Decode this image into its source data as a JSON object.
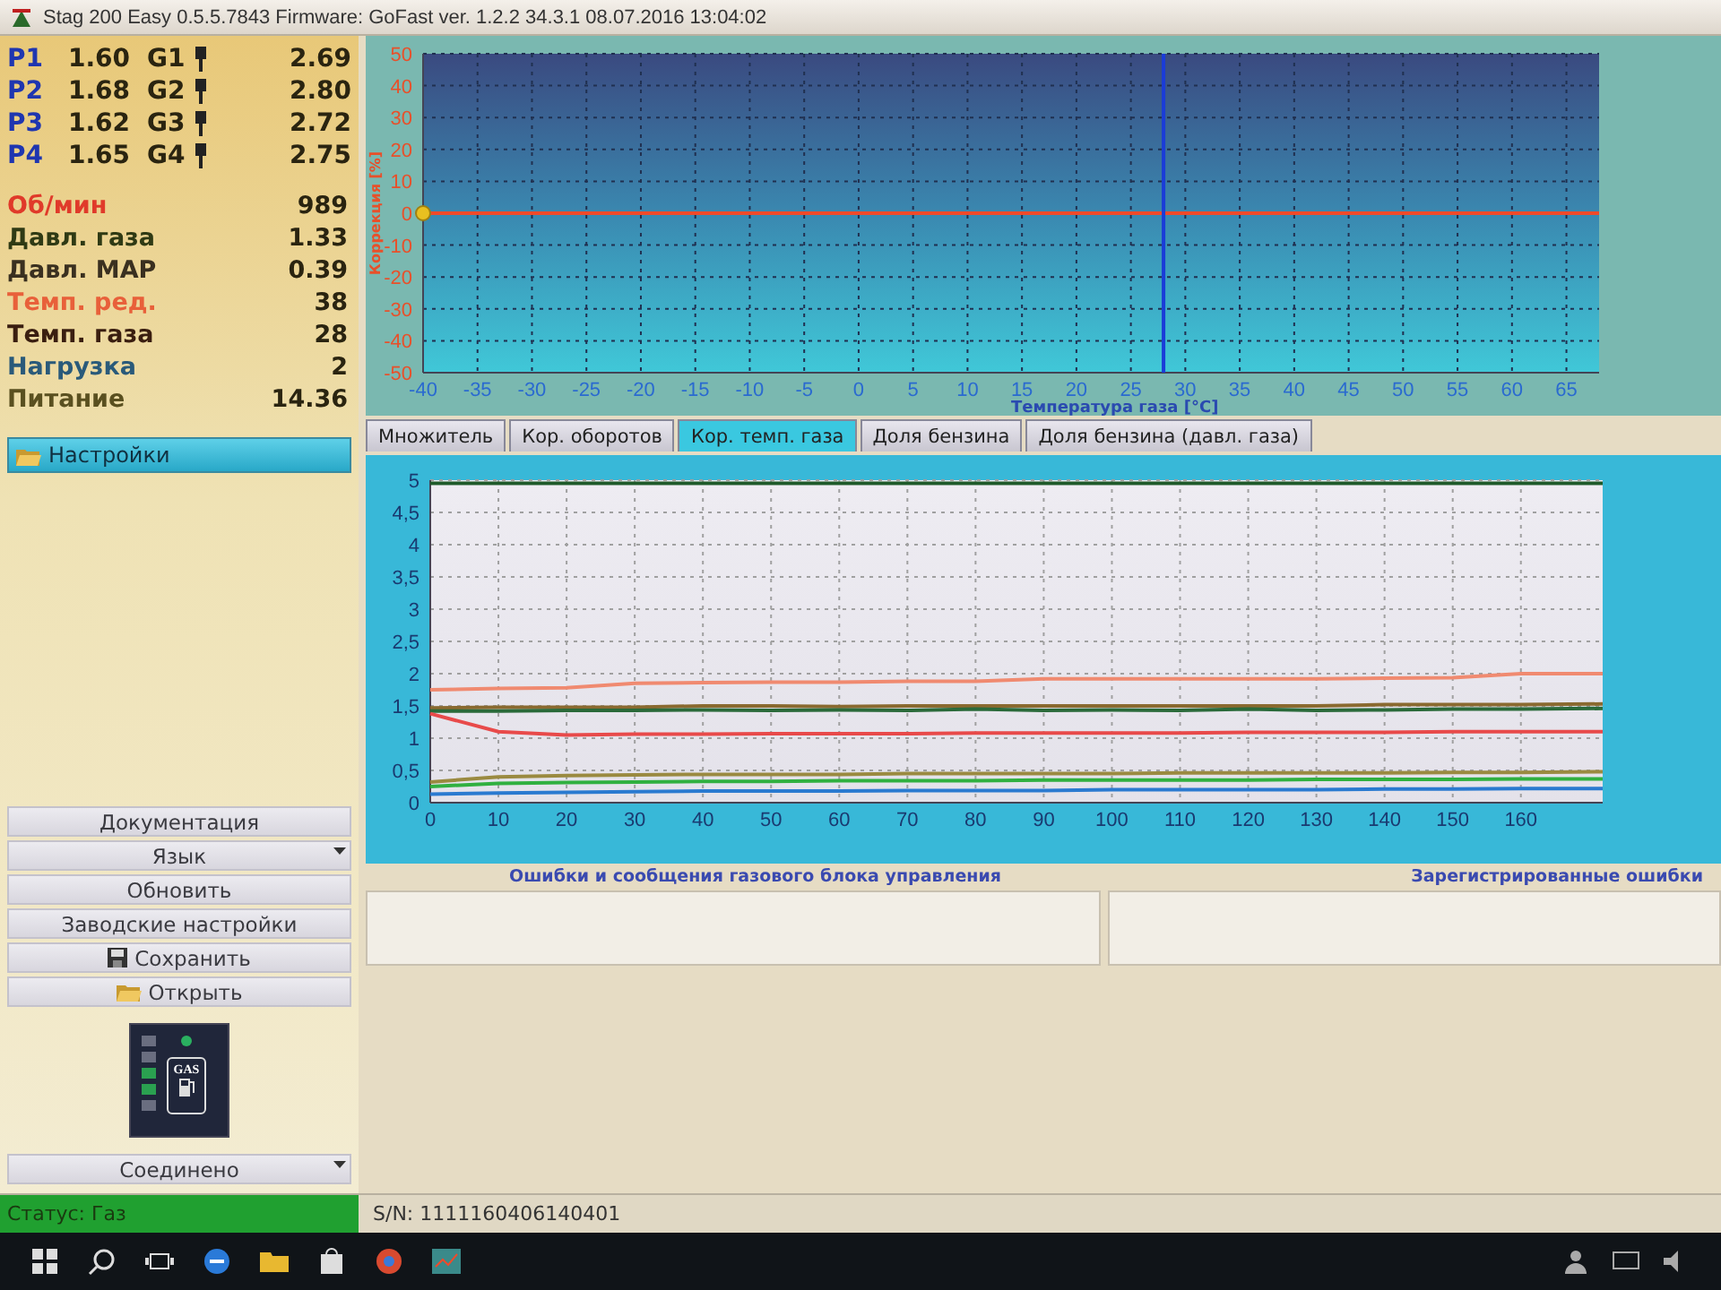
{
  "window": {
    "title": "Stag 200 Easy 0.5.5.7843 Firmware: GoFast  ver. 1.2.2  34.3.1   08.07.2016 13:04:02"
  },
  "injectors": [
    {
      "p_label": "P1",
      "p_value": "1.60",
      "g_label": "G1",
      "g_value": "2.69"
    },
    {
      "p_label": "P2",
      "p_value": "1.68",
      "g_label": "G2",
      "g_value": "2.80"
    },
    {
      "p_label": "P3",
      "p_value": "1.62",
      "g_label": "G3",
      "g_value": "2.72"
    },
    {
      "p_label": "P4",
      "p_value": "1.65",
      "g_label": "G4",
      "g_value": "2.75"
    }
  ],
  "parameters": [
    {
      "label": "Об/мин",
      "value": "989",
      "color": "#e03a2a"
    },
    {
      "label": "Давл. газа",
      "value": "1.33",
      "color": "#2f3a14"
    },
    {
      "label": "Давл. MAP",
      "value": "0.39",
      "color": "#3a3020"
    },
    {
      "label": "Темп. ред.",
      "value": "38",
      "color": "#e8603a"
    },
    {
      "label": "Темп. газа",
      "value": "28",
      "color": "#3a1e10"
    },
    {
      "label": "Нагрузка",
      "value": "2",
      "color": "#2a5a7a"
    },
    {
      "label": "Питание",
      "value": "14.36",
      "color": "#5a5020"
    }
  ],
  "settings": {
    "label": "Настройки"
  },
  "buttons": [
    {
      "label": "Документация",
      "kind": "plain"
    },
    {
      "label": "Язык",
      "kind": "dropdown"
    },
    {
      "label": "Обновить",
      "kind": "plain"
    },
    {
      "label": "Заводские настройки",
      "kind": "plain"
    },
    {
      "label": "Сохранить",
      "kind": "save"
    },
    {
      "label": "Открыть",
      "kind": "open"
    }
  ],
  "gas_indicator": {
    "label": "GAS",
    "leds": [
      {
        "on": false
      },
      {
        "on": false
      },
      {
        "on": true
      },
      {
        "on": true
      },
      {
        "on": false
      }
    ],
    "gas_led_on": true
  },
  "connection": {
    "value": "Соединено"
  },
  "top_chart": {
    "chart_data": {
      "type": "line",
      "xlabel": "Температура газа [°C]",
      "ylabel": "Коррекция [%]",
      "xlim": [
        -40,
        68
      ],
      "ylim": [
        -50,
        50
      ],
      "xticks": [
        -40,
        -35,
        -30,
        -25,
        -20,
        -15,
        -10,
        -5,
        0,
        5,
        10,
        15,
        20,
        25,
        30,
        35,
        40,
        45,
        50,
        55,
        60,
        65
      ],
      "yticks": [
        -50,
        -40,
        -30,
        -20,
        -10,
        0,
        10,
        20,
        30,
        40,
        50
      ],
      "x": [
        -40,
        68
      ],
      "grid": true,
      "series": [
        {
          "color": "#f04a2a",
          "values": [
            0,
            0
          ]
        }
      ],
      "ref_lines": [
        {
          "axis": "x",
          "value": 28,
          "color": "#1a3cd8"
        }
      ]
    }
  },
  "tabs": [
    {
      "label": "Множитель",
      "selected": false
    },
    {
      "label": "Кор. оборотов",
      "selected": false
    },
    {
      "label": "Кор. темп. газа",
      "selected": true
    },
    {
      "label": "Доля бензина",
      "selected": false
    },
    {
      "label": "Доля бензина (давл. газа)",
      "selected": false
    }
  ],
  "bottom_chart": {
    "chart_data": {
      "type": "line",
      "xlim": [
        0,
        172
      ],
      "ylim": [
        0,
        5
      ],
      "grid": true,
      "xticks": [
        0,
        10,
        20,
        30,
        40,
        50,
        60,
        70,
        80,
        90,
        100,
        110,
        120,
        130,
        140,
        150,
        160
      ],
      "yticks": [
        0,
        {
          "value": 0.5,
          "label": "0,5"
        },
        1,
        {
          "value": 1.5,
          "label": "1,5"
        },
        2,
        {
          "value": 2.5,
          "label": "2,5"
        },
        3,
        {
          "value": 3.5,
          "label": "3,5"
        },
        4,
        {
          "value": 4.5,
          "label": "4,5"
        },
        5
      ],
      "x": [
        0,
        10,
        20,
        30,
        40,
        50,
        60,
        70,
        80,
        90,
        100,
        110,
        120,
        130,
        140,
        150,
        160,
        172
      ],
      "series": [
        {
          "color": "#1e5a2a",
          "values": [
            4.95,
            4.95,
            4.95,
            4.95,
            4.95,
            4.95,
            4.95,
            4.95,
            4.95,
            4.95,
            4.95,
            4.95,
            4.95,
            4.95,
            4.95,
            4.95,
            4.95,
            4.95
          ]
        },
        {
          "color": "#f08a70",
          "values": [
            1.75,
            1.77,
            1.78,
            1.85,
            1.86,
            1.87,
            1.87,
            1.88,
            1.88,
            1.92,
            1.92,
            1.92,
            1.92,
            1.92,
            1.93,
            1.94,
            2.0,
            2.0
          ]
        },
        {
          "color": "#8a6a30",
          "values": [
            1.47,
            1.48,
            1.48,
            1.48,
            1.5,
            1.5,
            1.49,
            1.5,
            1.5,
            1.5,
            1.5,
            1.5,
            1.5,
            1.5,
            1.52,
            1.52,
            1.52,
            1.53
          ]
        },
        {
          "color": "#2a6a3a",
          "values": [
            1.42,
            1.42,
            1.43,
            1.43,
            1.44,
            1.43,
            1.44,
            1.43,
            1.45,
            1.43,
            1.44,
            1.43,
            1.45,
            1.43,
            1.44,
            1.45,
            1.45,
            1.46
          ]
        },
        {
          "color": "#e84a4a",
          "values": [
            1.38,
            1.1,
            1.05,
            1.06,
            1.06,
            1.07,
            1.07,
            1.07,
            1.08,
            1.08,
            1.08,
            1.08,
            1.09,
            1.09,
            1.09,
            1.1,
            1.1,
            1.1
          ]
        },
        {
          "color": "#9a8a40",
          "values": [
            0.32,
            0.4,
            0.42,
            0.43,
            0.44,
            0.44,
            0.44,
            0.45,
            0.45,
            0.45,
            0.45,
            0.46,
            0.46,
            0.46,
            0.46,
            0.47,
            0.47,
            0.48
          ]
        },
        {
          "color": "#30b040",
          "values": [
            0.25,
            0.3,
            0.31,
            0.32,
            0.33,
            0.33,
            0.34,
            0.34,
            0.34,
            0.35,
            0.35,
            0.35,
            0.35,
            0.36,
            0.36,
            0.36,
            0.37,
            0.37
          ]
        },
        {
          "color": "#2a7ad0",
          "values": [
            0.13,
            0.15,
            0.16,
            0.17,
            0.18,
            0.18,
            0.18,
            0.19,
            0.19,
            0.19,
            0.2,
            0.2,
            0.2,
            0.2,
            0.21,
            0.21,
            0.22,
            0.22
          ]
        }
      ]
    }
  },
  "errors_panel": {
    "title": "Ошибки и сообщения газового блока управления"
  },
  "registered_errors_panel": {
    "title": "Зарегистрированные ошибки"
  },
  "status_bar": {
    "status": "Статус: Газ",
    "serial": "S/N: 1111160406140401"
  }
}
